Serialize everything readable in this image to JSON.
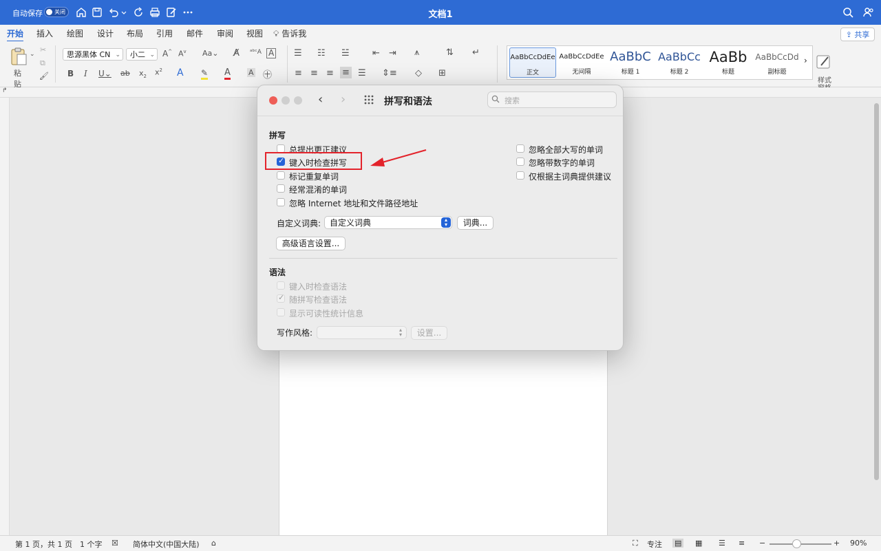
{
  "titlebar": {
    "autosave_label": "自动保存",
    "autosave_toggle": "关闭",
    "doc_title": "文档1"
  },
  "ribbon": {
    "tabs": [
      "开始",
      "插入",
      "绘图",
      "设计",
      "布局",
      "引用",
      "邮件",
      "审阅",
      "视图"
    ],
    "tell_me": "告诉我",
    "share": "共享",
    "paste": "粘贴",
    "font_name": "思源黑体 CN",
    "font_size": "小二",
    "styles": [
      {
        "sample": "AaBbCcDdEe",
        "label": "正文"
      },
      {
        "sample": "AaBbCcDdEe",
        "label": "无间隔"
      },
      {
        "sample": "AaBbC",
        "label": "标题 1"
      },
      {
        "sample": "AaBbCc",
        "label": "标题 2"
      },
      {
        "sample": "AaBb",
        "label": "标题"
      },
      {
        "sample": "AaBbCcDd",
        "label": "副标题"
      }
    ],
    "styles_pane": "样式\n窗格"
  },
  "dialog": {
    "title": "拼写和语法",
    "search_placeholder": "搜索",
    "spelling": {
      "title": "拼写",
      "left_options": [
        {
          "label": "总提出更正建议",
          "checked": false
        },
        {
          "label": "键入时检查拼写",
          "checked": true
        },
        {
          "label": "标记重复单词",
          "checked": false
        },
        {
          "label": "经常混淆的单词",
          "checked": false
        },
        {
          "label": "忽略 Internet 地址和文件路径地址",
          "checked": false
        }
      ],
      "right_options": [
        {
          "label": "忽略全部大写的单词",
          "checked": false
        },
        {
          "label": "忽略带数字的单词",
          "checked": false
        },
        {
          "label": "仅根据主词典提供建议",
          "checked": false
        }
      ],
      "custom_dict_label": "自定义词典:",
      "custom_dict_value": "自定义词典",
      "dict_button": "词典...",
      "advanced_button": "高级语言设置..."
    },
    "grammar": {
      "title": "语法",
      "options": [
        {
          "label": "键入时检查语法",
          "checked": false
        },
        {
          "label": "随拼写检查语法",
          "checked": true
        },
        {
          "label": "显示可读性统计信息",
          "checked": false
        }
      ],
      "style_label": "写作风格:",
      "style_value": "",
      "settings_button": "设置..."
    }
  },
  "statusbar": {
    "page": "第 1 页，共 1 页",
    "words": "1 个字",
    "language": "简体中文(中国大陆)",
    "focus": "专注",
    "zoom": "90%"
  },
  "annotation_color": "#e3232b",
  "accent_color": "#2464d8"
}
